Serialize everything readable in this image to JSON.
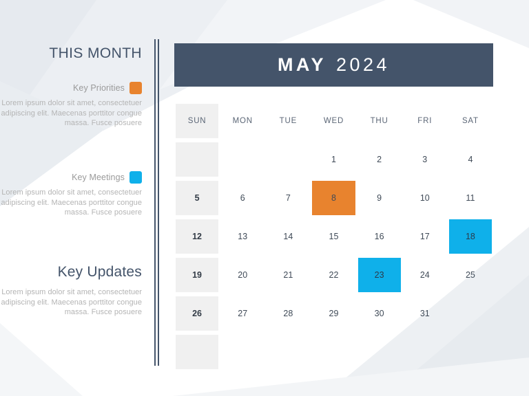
{
  "slide": {
    "background_color": "#ffffff",
    "accent_dark": "#44546a",
    "accent_orange": "#e8832e",
    "accent_blue": "#0fb0ea",
    "sunday_tint": "#f0f0f0"
  },
  "sidebar": {
    "title": "THIS MONTH",
    "legend": [
      {
        "label": "Key Priorities",
        "swatch_color": "#e8832e",
        "swatch_name": "orange",
        "body": "Lorem ipsum dolor sit amet, consectetuer adipiscing elit. Maecenas porttitor congue massa. Fusce posuere"
      },
      {
        "label": "Key Meetings",
        "swatch_color": "#0fb0ea",
        "swatch_name": "blue",
        "body": "Lorem ipsum dolor sit amet, consectetuer adipiscing elit. Maecenas porttitor congue massa. Fusce posuere"
      }
    ],
    "updates": {
      "title": "Key Updates",
      "body": "Lorem ipsum dolor sit amet, consectetuer adipiscing elit. Maecenas porttitor congue massa. Fusce posuere"
    }
  },
  "calendar": {
    "month": "MAY",
    "year": "2024",
    "weekdays": [
      "SUN",
      "MON",
      "TUE",
      "WED",
      "THU",
      "FRI",
      "SAT"
    ],
    "weeks": [
      [
        {
          "day": ""
        },
        {
          "day": ""
        },
        {
          "day": ""
        },
        {
          "day": "1"
        },
        {
          "day": "2"
        },
        {
          "day": "3"
        },
        {
          "day": "4"
        }
      ],
      [
        {
          "day": "5"
        },
        {
          "day": "6"
        },
        {
          "day": "7"
        },
        {
          "day": "8",
          "highlight": "orange"
        },
        {
          "day": "9"
        },
        {
          "day": "10"
        },
        {
          "day": "11"
        }
      ],
      [
        {
          "day": "12"
        },
        {
          "day": "13"
        },
        {
          "day": "14"
        },
        {
          "day": "15"
        },
        {
          "day": "16"
        },
        {
          "day": "17"
        },
        {
          "day": "18",
          "highlight": "blue"
        }
      ],
      [
        {
          "day": "19"
        },
        {
          "day": "20"
        },
        {
          "day": "21"
        },
        {
          "day": "22"
        },
        {
          "day": "23",
          "highlight": "blue"
        },
        {
          "day": "24"
        },
        {
          "day": "25"
        }
      ],
      [
        {
          "day": "26"
        },
        {
          "day": "27"
        },
        {
          "day": "28"
        },
        {
          "day": "29"
        },
        {
          "day": "30"
        },
        {
          "day": "31"
        },
        {
          "day": ""
        }
      ],
      [
        {
          "day": ""
        },
        {
          "day": ""
        },
        {
          "day": ""
        },
        {
          "day": ""
        },
        {
          "day": ""
        },
        {
          "day": ""
        },
        {
          "day": ""
        }
      ]
    ]
  }
}
